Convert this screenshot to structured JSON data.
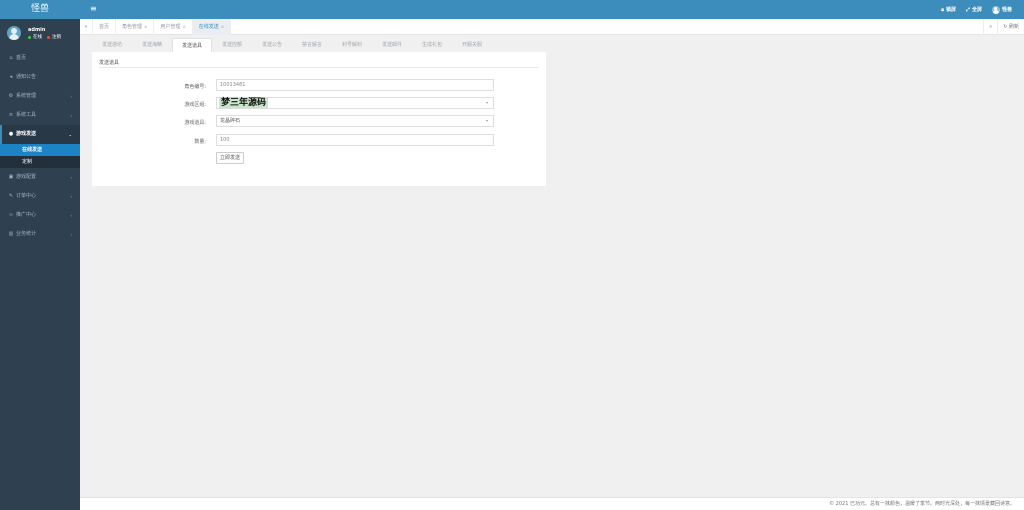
{
  "app": {
    "logo": "怪兽"
  },
  "user": {
    "name": "admin",
    "online": "在线",
    "logout": "注销"
  },
  "sidebar": {
    "items": [
      {
        "label": "首页",
        "icon": "home-icon"
      },
      {
        "label": "通知公告",
        "icon": "bullhorn-icon"
      },
      {
        "label": "系统管理",
        "icon": "gear-icon",
        "caret": "‹"
      },
      {
        "label": "系统工具",
        "icon": "bars-icon",
        "caret": "‹"
      },
      {
        "label": "游戏发送",
        "icon": "gamepad-icon",
        "caret": "⌄",
        "open": true,
        "children": [
          {
            "label": "在线发送",
            "active": true
          },
          {
            "label": "定制"
          }
        ]
      },
      {
        "label": "游戏配置",
        "icon": "cube-icon",
        "caret": "‹"
      },
      {
        "label": "订单中心",
        "icon": "pencil-icon",
        "caret": "‹"
      },
      {
        "label": "推广中心",
        "icon": "link-icon",
        "caret": "‹"
      },
      {
        "label": "业务统计",
        "icon": "chart-icon",
        "caret": "‹"
      }
    ]
  },
  "topbar": {
    "lock": "锁屏",
    "fullscreen": "全屏",
    "username": "怪兽"
  },
  "page_tabs": {
    "tabs": [
      {
        "label": "首页",
        "closable": false
      },
      {
        "label": "角色管理",
        "closable": true
      },
      {
        "label": "用户管理",
        "closable": true
      },
      {
        "label": "在线发送",
        "closable": true,
        "active": true
      }
    ],
    "refresh": "刷新"
  },
  "subtabs": [
    "发送游坊",
    "发送海精",
    "发送道具",
    "发送控额",
    "发送公告",
    "禁言解言",
    "封号解封",
    "发送邮件",
    "生成礼包",
    "开服关服"
  ],
  "form": {
    "title": "发送道具",
    "role_label": "角色编号:",
    "role_value": "10013481",
    "server_label": "游戏区组:",
    "server_value": "梦三年源码",
    "item_label": "游戏道具:",
    "item_value": "龙晶碎石",
    "qty_label": "数量:",
    "qty_value": "100",
    "submit": "立即发送"
  },
  "footer": {
    "text": "© 2021 已功元。总有一抹颜色，温暖了季节。两时光深处，每一抹情景藏回诗意。"
  }
}
